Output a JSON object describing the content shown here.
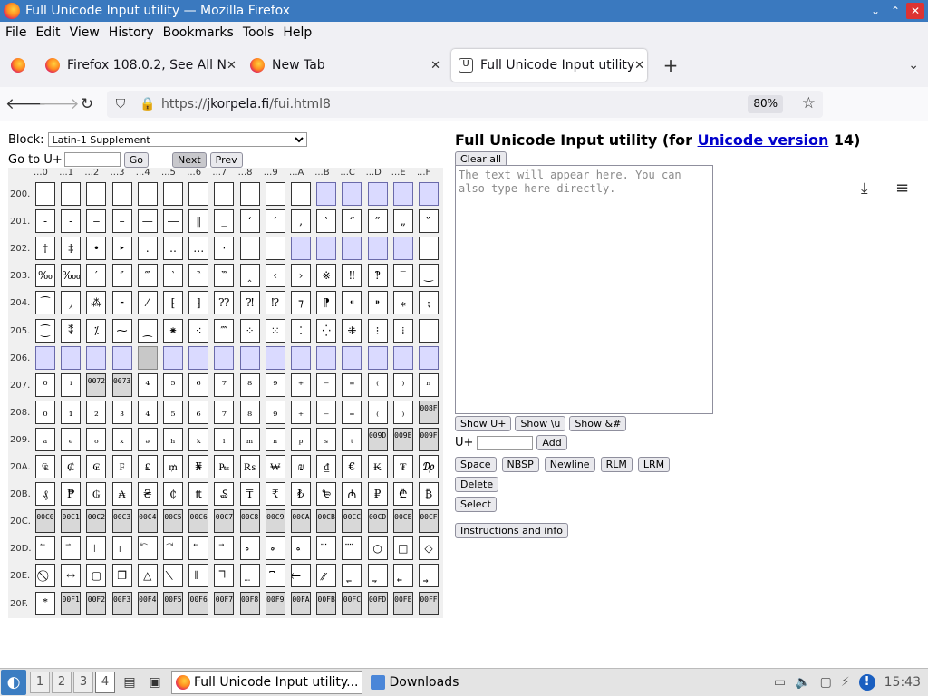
{
  "window": {
    "title": "Full Unicode Input utility — Mozilla Firefox",
    "controls": [
      "⌄",
      "⌃",
      "✕"
    ]
  },
  "menu": [
    "File",
    "Edit",
    "View",
    "History",
    "Bookmarks",
    "Tools",
    "Help"
  ],
  "tabs": [
    {
      "label": "Firefox 108.0.2, See All N",
      "close": "✕"
    },
    {
      "label": "New Tab",
      "close": "✕"
    },
    {
      "label": "Full Unicode Input utility",
      "close": "✕",
      "favicon_glyph": "U",
      "active": true
    }
  ],
  "nav": {
    "back": "🡐",
    "forward": "🡒",
    "reload": "↻",
    "url_prefix": "https://",
    "url_domain": "jkorpela.fi",
    "url_path": "/fui.html8",
    "zoom": "80%",
    "bookmark": "☆",
    "download": "⤓",
    "menu": "≡",
    "newtab": "+",
    "tablist": "⌄"
  },
  "left": {
    "block_label": "Block:",
    "block_value": "Latin-1 Supplement",
    "goto_label": "Go to U+",
    "go": "Go",
    "next": "Next",
    "prev": "Prev"
  },
  "grid": {
    "col_heads": [
      "...0",
      "...1",
      "...2",
      "...3",
      "...4",
      "...5",
      "...6",
      "...7",
      "...8",
      "...9",
      "...A",
      "...B",
      "...C",
      "...D",
      "...E",
      "...F"
    ],
    "rows": [
      {
        "label": "200.",
        "cells": [
          "b",
          "b",
          "b",
          "b",
          "b",
          "b",
          "b",
          "b",
          "b",
          "b",
          "b",
          "u",
          "u",
          "u",
          "u",
          "u"
        ]
      },
      {
        "label": "201.",
        "cells": [
          "‐",
          "‑",
          "‒",
          "–",
          "—",
          "―",
          "‖",
          "‗",
          "‘",
          "’",
          "‚",
          "‛",
          "“",
          "”",
          "„",
          "‟"
        ]
      },
      {
        "label": "202.",
        "cells": [
          "†",
          "‡",
          "•",
          "‣",
          "․",
          "‥",
          "…",
          "‧",
          "b",
          "b",
          "u",
          "u",
          "u",
          "u",
          "u",
          "b"
        ]
      },
      {
        "label": "203.",
        "cells": [
          "‰",
          "‱",
          "′",
          "″",
          "‴",
          "‵",
          "‶",
          "‷",
          "‸",
          "‹",
          "›",
          "※",
          "‼",
          "‽",
          "‾",
          "‿"
        ]
      },
      {
        "label": "204.",
        "cells": [
          "⁀",
          "⁁",
          "⁂",
          "⁃",
          "⁄",
          "⁅",
          "⁆",
          "⁇",
          "⁈",
          "⁉",
          "⁊",
          "⁋",
          "⁌",
          "⁍",
          "⁎",
          "⁏"
        ]
      },
      {
        "label": "205.",
        "cells": [
          "⁐",
          "⁑",
          "⁒",
          "⁓",
          "⁔",
          "⁕",
          "⁖",
          "⁗",
          "⁘",
          "⁙",
          "⁚",
          "⁛",
          "⁜",
          "⁝",
          "⁞",
          "b"
        ]
      },
      {
        "label": "206.",
        "cells": [
          "u",
          "u",
          "u",
          "u",
          "g",
          "u",
          "u",
          "u",
          "u",
          "u",
          "u",
          "u",
          "u",
          "u",
          "u",
          "u"
        ]
      },
      {
        "label": "207.",
        "cells": [
          "⁰",
          "ⁱ",
          "bx:0072",
          "bx:0073",
          "⁴",
          "⁵",
          "⁶",
          "⁷",
          "⁸",
          "⁹",
          "⁺",
          "⁻",
          "⁼",
          "⁽",
          "⁾",
          "ⁿ"
        ]
      },
      {
        "label": "208.",
        "cells": [
          "₀",
          "₁",
          "₂",
          "₃",
          "₄",
          "₅",
          "₆",
          "₇",
          "₈",
          "₉",
          "₊",
          "₋",
          "₌",
          "₍",
          "₎",
          "bx:008F"
        ]
      },
      {
        "label": "209.",
        "cells": [
          "ₐ",
          "ₑ",
          "ₒ",
          "ₓ",
          "ₔ",
          "ₕ",
          "ₖ",
          "ₗ",
          "ₘ",
          "ₙ",
          "ₚ",
          "ₛ",
          "ₜ",
          "bx:009D",
          "bx:009E",
          "bx:009F"
        ]
      },
      {
        "label": "20A.",
        "cells": [
          "₠",
          "₡",
          "₢",
          "₣",
          "₤",
          "₥",
          "₦",
          "₧",
          "₨",
          "₩",
          "₪",
          "₫",
          "€",
          "₭",
          "₮",
          "₯"
        ]
      },
      {
        "label": "20B.",
        "cells": [
          "₰",
          "₱",
          "₲",
          "₳",
          "₴",
          "₵",
          "₶",
          "₷",
          "₸",
          "₹",
          "₺",
          "₻",
          "₼",
          "₽",
          "₾",
          "₿"
        ]
      },
      {
        "label": "20C.",
        "cells": [
          "bx:00C0",
          "bx:00C1",
          "bx:00C2",
          "bx:00C3",
          "bx:00C4",
          "bx:00C5",
          "bx:00C6",
          "bx:00C7",
          "bx:00C8",
          "bx:00C9",
          "bx:00CA",
          "bx:00CB",
          "bx:00CC",
          "bx:00CD",
          "bx:00CE",
          "bx:00CF"
        ]
      },
      {
        "label": "20D.",
        "cells": [
          "⃐",
          "⃑",
          "⃒",
          "⃓",
          "⃔",
          "⃕",
          "⃖",
          "⃗",
          "⃘",
          "⃙",
          "⃚",
          "⃛",
          "⃜",
          "○",
          "□",
          "◇"
        ]
      },
      {
        "label": "20E.",
        "cells": [
          "⃠",
          "↔",
          "▢",
          "❐",
          "△",
          "⃥",
          "⃦",
          "⃧",
          "⃨",
          "⃩",
          "⃪",
          "⃫",
          "⃬",
          "⃭",
          "⃮",
          "⃯"
        ]
      },
      {
        "label": "20F.",
        "cells": [
          "⃰",
          "bx:00F1",
          "bx:00F2",
          "bx:00F3",
          "bx:00F4",
          "bx:00F5",
          "bx:00F6",
          "bx:00F7",
          "bx:00F8",
          "bx:00F9",
          "bx:00FA",
          "bx:00FB",
          "bx:00FC",
          "bx:00FD",
          "bx:00FE",
          "bx:00FF"
        ]
      }
    ]
  },
  "right": {
    "title_pre": "Full Unicode Input utility (for ",
    "title_link": "Unicode version",
    "title_post": " 14)",
    "clear_all": "Clear all",
    "textarea_placeholder": "The text will appear here. You can also type here directly.",
    "show_buttons": [
      "Show U+",
      "Show \\u",
      "Show &#"
    ],
    "add_label": "U+",
    "add": "Add",
    "special_buttons": [
      "Space",
      "NBSP",
      "Newline",
      "RLM",
      "LRM"
    ],
    "delete": "Delete",
    "select": "Select",
    "instructions": "Instructions and info"
  },
  "taskbar": {
    "workspaces": [
      "1",
      "2",
      "3",
      "4"
    ],
    "current_workspace": "4",
    "tasks": [
      "Full Unicode Input utility...",
      "Downloads"
    ],
    "clock": "15:43",
    "alert": "!"
  },
  "colors": {
    "titlebar": "#3a79bf",
    "unassigned_cell": "#dadaff",
    "link": "#0000cc"
  }
}
